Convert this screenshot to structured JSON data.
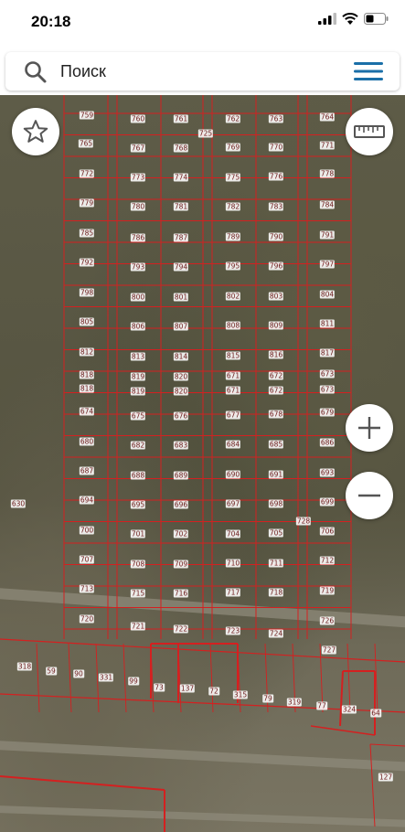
{
  "status_bar": {
    "time": "20:18"
  },
  "search": {
    "placeholder": "Поиск"
  },
  "map": {
    "plots": [
      "759",
      "760",
      "761",
      "762",
      "763",
      "764",
      "765",
      "767",
      "768",
      "769",
      "770",
      "771",
      "772",
      "773",
      "774",
      "775",
      "776",
      "778",
      "779",
      "780",
      "781",
      "782",
      "783",
      "784",
      "785",
      "786",
      "787",
      "789",
      "790",
      "791",
      "792",
      "793",
      "794",
      "795",
      "796",
      "797",
      "798",
      "800",
      "801",
      "802",
      "803",
      "804",
      "805",
      "806",
      "807",
      "808",
      "809",
      "811",
      "812",
      "813",
      "814",
      "815",
      "816",
      "817",
      "818",
      "819",
      "820",
      "671",
      "672",
      "673",
      "818",
      "819",
      "820",
      "671",
      "672",
      "673",
      "674",
      "675",
      "676",
      "677",
      "678",
      "679",
      "680",
      "682",
      "683",
      "684",
      "685",
      "686",
      "687",
      "688",
      "689",
      "690",
      "691",
      "693",
      "694",
      "695",
      "696",
      "697",
      "698",
      "699",
      "700",
      "701",
      "702",
      "704",
      "705",
      "706",
      "707",
      "708",
      "709",
      "710",
      "711",
      "712",
      "713",
      "715",
      "716",
      "717",
      "718",
      "719",
      "720",
      "721",
      "722",
      "723",
      "724",
      "726",
      "727",
      "630",
      "318",
      "59",
      "90",
      "331",
      "99",
      "73",
      "137",
      "72",
      "315",
      "79",
      "319",
      "77",
      "324",
      "64",
      "127",
      "725",
      "728"
    ],
    "buttons": {
      "favorite": "star-icon",
      "ruler": "ruler-icon",
      "zoom_in": "plus-icon",
      "zoom_out": "minus-icon"
    }
  }
}
